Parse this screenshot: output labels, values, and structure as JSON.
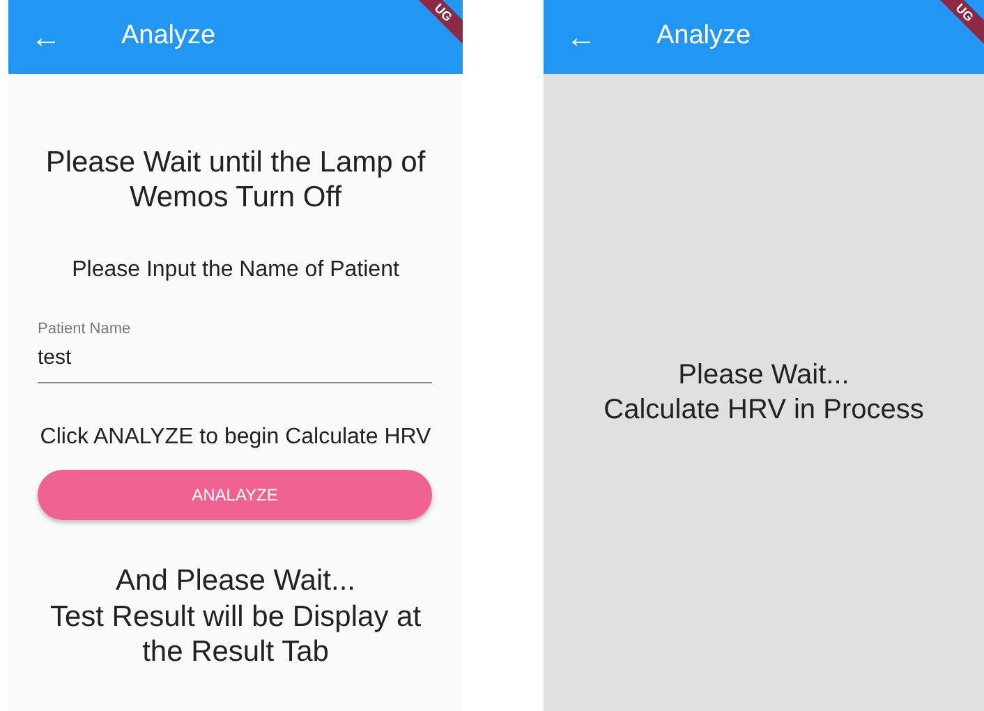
{
  "screens": [
    {
      "app_bar": {
        "back": "←",
        "title": "Analyze",
        "debug_banner": "UG"
      },
      "kind": "form",
      "heading": "Please Wait until the Lamp of Wemos Turn Off",
      "prompt": "Please Input the Name of Patient",
      "field": {
        "label": "Patient Name",
        "value": "test"
      },
      "instruction": "Click ANALYZE to begin Calculate HRV",
      "button": "ANALAYZE",
      "footer": "And Please Wait...\nTest Result will be Display at the Result Tab"
    },
    {
      "app_bar": {
        "back": "←",
        "title": "Analyze",
        "debug_banner": "UG"
      },
      "kind": "waiting",
      "message": "Please Wait...\nCalculate HRV in Process"
    }
  ]
}
